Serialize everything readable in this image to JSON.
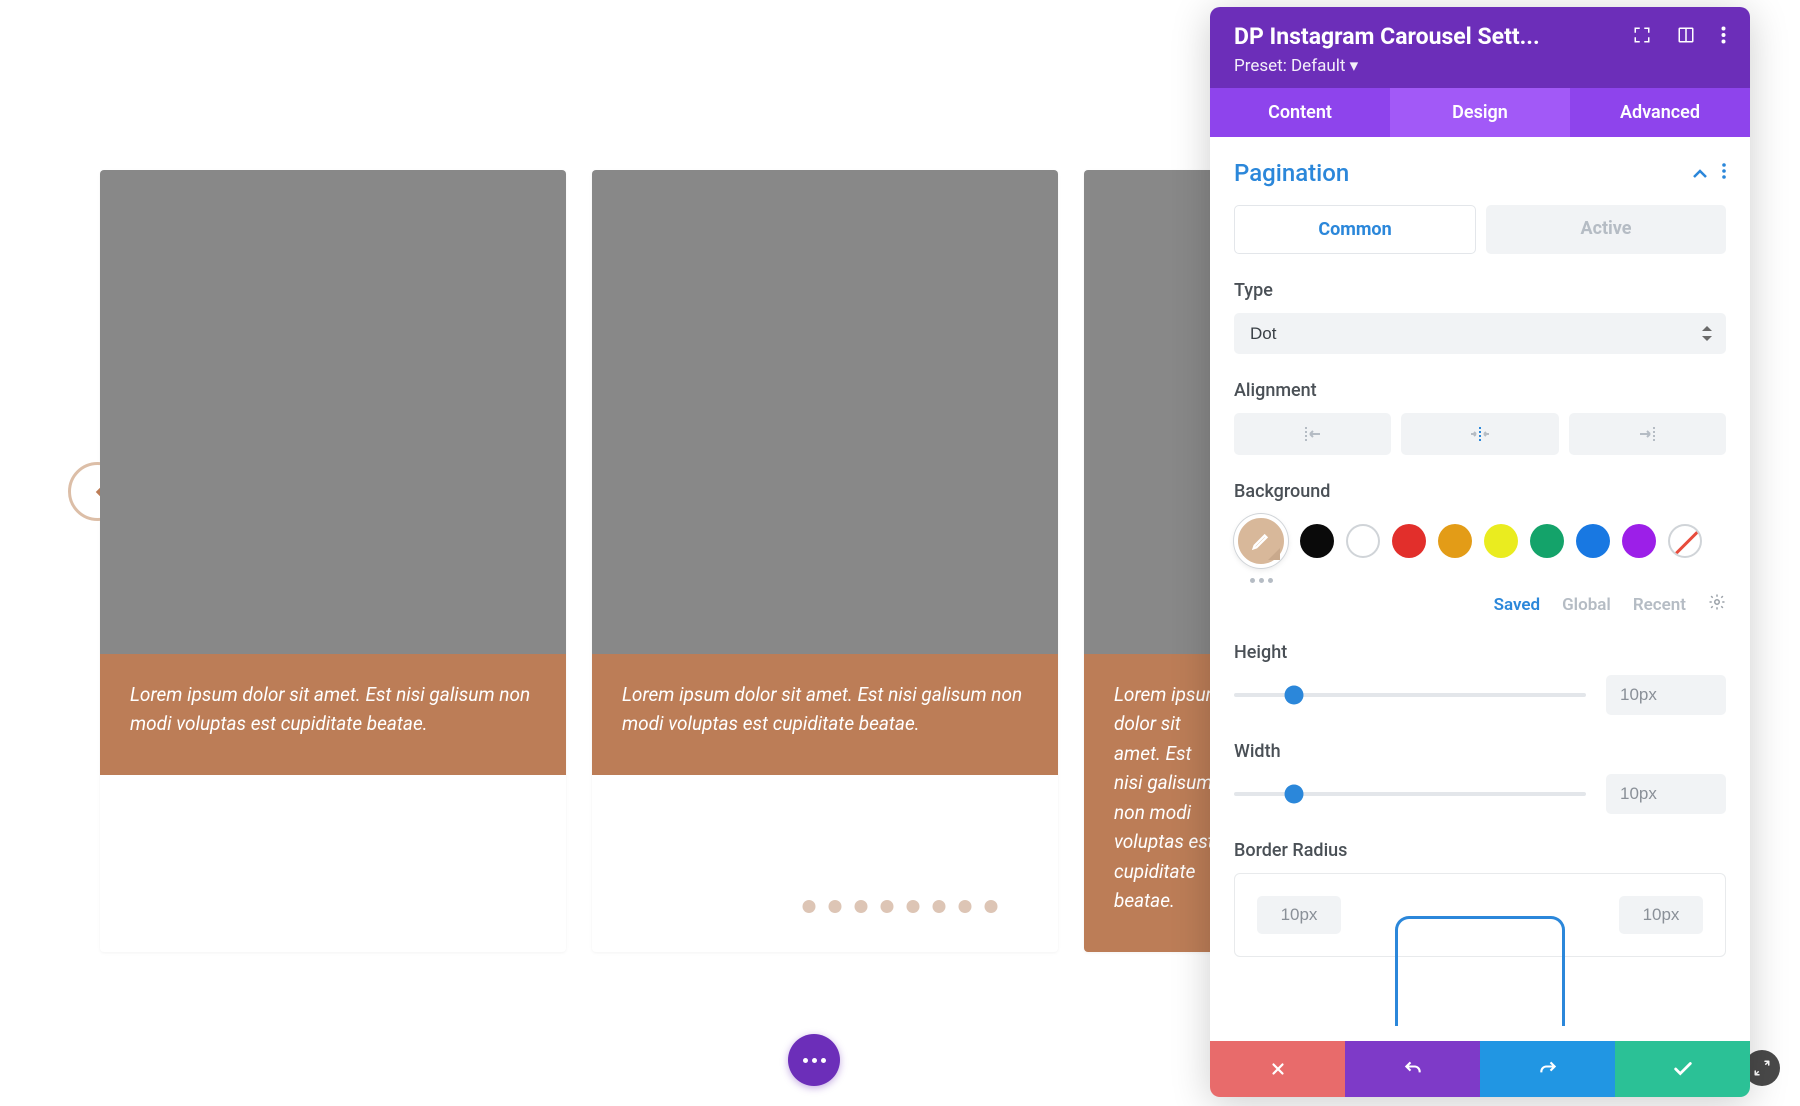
{
  "panel": {
    "title": "DP Instagram Carousel Sett...",
    "preset": "Preset: Default ▾",
    "tabs": {
      "content": "Content",
      "design": "Design",
      "advanced": "Advanced"
    },
    "section": {
      "title": "Pagination",
      "subtabs": {
        "common": "Common",
        "active": "Active"
      },
      "type_label": "Type",
      "type_value": "Dot",
      "alignment_label": "Alignment",
      "background_label": "Background",
      "color_tabs": {
        "saved": "Saved",
        "global": "Global",
        "recent": "Recent"
      },
      "height_label": "Height",
      "height_value": "10px",
      "width_label": "Width",
      "width_value": "10px",
      "border_radius_label": "Border Radius",
      "br_tl": "10px",
      "br_tr": "10px"
    },
    "swatch_colors": [
      "#d8b89a",
      "#0a0a0a",
      "#ffffff",
      "#e22f2b",
      "#e39c17",
      "#eaec1f",
      "#14a36a",
      "#1878e2",
      "#9c1fe8"
    ]
  },
  "carousel": {
    "caption1": "Lorem ipsum dolor sit amet. Est nisi galisum non modi voluptas est cupiditate beatae.",
    "caption2": "Lorem ipsum dolor sit amet. Est nisi galisum non modi voluptas est cupiditate beatae.",
    "caption3": "Lorem ipsum dolor sit amet. Est nisi galisum non modi voluptas est cupiditate beatae."
  }
}
